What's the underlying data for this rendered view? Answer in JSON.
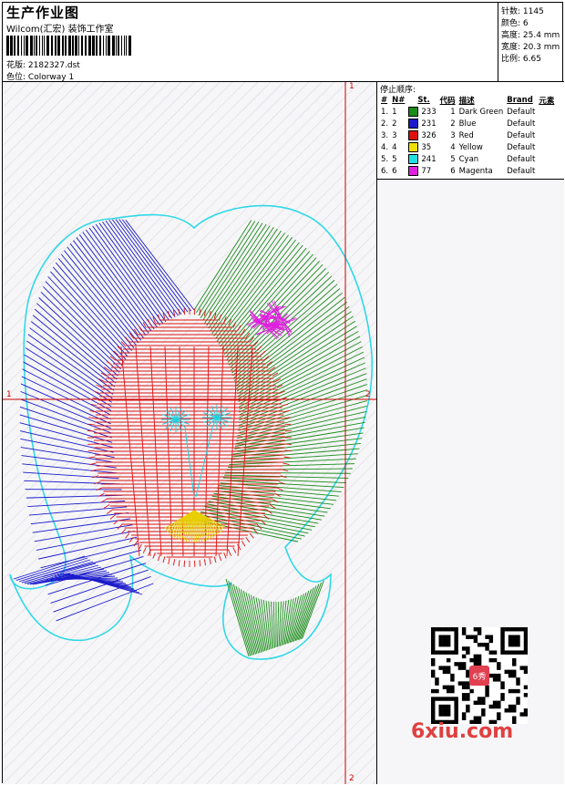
{
  "header": {
    "title": "生产作业图",
    "company": "Wilcom(汇宏) 装饰工作室",
    "design_label": "花版:",
    "design_value": "2182327.dst",
    "colorway_label": "色位:",
    "colorway_value": "Colorway 1"
  },
  "stats": {
    "stitches": "针数: 1145",
    "colors": "颜色: 6",
    "height": "高度: 25.4 mm",
    "width": "宽度: 20.3 mm",
    "scale": "比例: 6.65"
  },
  "stop_sequence": {
    "title": "停止顺序:",
    "headers": [
      "#",
      "N#",
      "St.",
      "代码",
      "描述",
      "Brand",
      "元素"
    ],
    "rows": [
      {
        "idx": "1.",
        "n": "1",
        "st": "233",
        "code": "1",
        "desc": "Dark Green",
        "brand": "Default",
        "color": "#1a8c1a"
      },
      {
        "idx": "2.",
        "n": "2",
        "st": "231",
        "code": "2",
        "desc": "Blue",
        "brand": "Default",
        "color": "#1a1acc"
      },
      {
        "idx": "3.",
        "n": "3",
        "st": "326",
        "code": "3",
        "desc": "Red",
        "brand": "Default",
        "color": "#e01010"
      },
      {
        "idx": "4.",
        "n": "4",
        "st": "35",
        "code": "4",
        "desc": "Yellow",
        "brand": "Default",
        "color": "#f0e000"
      },
      {
        "idx": "5.",
        "n": "5",
        "st": "241",
        "code": "5",
        "desc": "Cyan",
        "brand": "Default",
        "color": "#20e0e0"
      },
      {
        "idx": "6.",
        "n": "6",
        "st": "77",
        "code": "6",
        "desc": "Magenta",
        "brand": "Default",
        "color": "#e020e0"
      }
    ]
  },
  "axes": {
    "top_label": "1",
    "bottom_label": "2",
    "left_label": "1",
    "right_label": "2"
  },
  "watermark": "6xiu.com",
  "qr_badge": "6秀"
}
